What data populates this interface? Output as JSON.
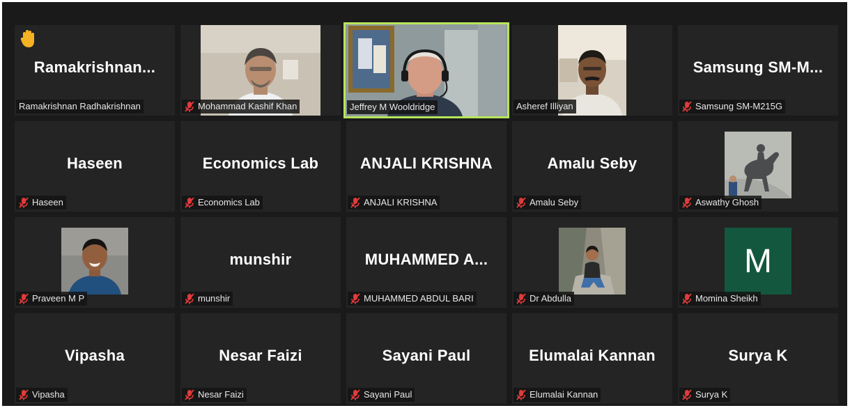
{
  "hand_raised_name": "Ramakrishnan Radhakrishnan",
  "tiles": [
    {
      "id": "ramakrishnan",
      "display": "Ramakrishnan...",
      "label": "Ramakrishnan Radhakrishnan",
      "muted": false,
      "hand_raised": true
    },
    {
      "id": "kashif",
      "display": "",
      "label": "Mohammad Kashif Khan",
      "muted": true,
      "video": "man-white-shirt"
    },
    {
      "id": "jeffrey",
      "display": "",
      "label": "Jeffrey M Wooldridge",
      "muted": false,
      "active_speaker": true,
      "video": "man-headset"
    },
    {
      "id": "asheref",
      "display": "",
      "label": "Asheref Illiyan",
      "muted": false,
      "video": "man-mustache"
    },
    {
      "id": "samsung",
      "display": "Samsung SM-M...",
      "label": "Samsung SM-M215G",
      "muted": true
    },
    {
      "id": "haseen",
      "display": "Haseen",
      "label": "Haseen",
      "muted": true
    },
    {
      "id": "econlab",
      "display": "Economics Lab",
      "label": "Economics Lab",
      "muted": true
    },
    {
      "id": "anjali",
      "display": "ANJALI KRISHNA",
      "label": "ANJALI KRISHNA",
      "muted": true
    },
    {
      "id": "amalu",
      "display": "Amalu Seby",
      "label": "Amalu Seby",
      "muted": true
    },
    {
      "id": "aswathy",
      "display": "",
      "label": "Aswathy Ghosh",
      "muted": true,
      "video": "horse-rider-image"
    },
    {
      "id": "praveen",
      "display": "",
      "label": "Praveen M P",
      "muted": true,
      "video": "man-photo"
    },
    {
      "id": "munshir",
      "display": "munshir",
      "label": "munshir",
      "muted": true
    },
    {
      "id": "muhammed",
      "display": "MUHAMMED A...",
      "label": "MUHAMMED ABDUL BARI",
      "muted": true
    },
    {
      "id": "abdulla",
      "display": "",
      "label": "Dr Abdulla",
      "muted": true,
      "video": "man-sitting-on-rock"
    },
    {
      "id": "momina",
      "display": "",
      "label": "Momina Sheikh",
      "muted": true,
      "avatar_letter": "M",
      "avatar_color": "#14573f"
    },
    {
      "id": "vipasha",
      "display": "Vipasha",
      "label": "Vipasha",
      "muted": true
    },
    {
      "id": "nesar",
      "display": "Nesar Faizi",
      "label": "Nesar Faizi",
      "muted": true
    },
    {
      "id": "sayani",
      "display": "Sayani Paul",
      "label": "Sayani Paul",
      "muted": true
    },
    {
      "id": "elumalai",
      "display": "Elumalai Kannan",
      "label": "Elumalai Kannan",
      "muted": true
    },
    {
      "id": "surya",
      "display": "Surya K",
      "label": "Surya K",
      "muted": true
    }
  ],
  "colors": {
    "background": "#1a1a1a",
    "tile": "#242424",
    "active_border": "#b7e55a",
    "muted_icon": "#e03b3b",
    "hand_icon": "#f5b324"
  },
  "icons": {
    "muted": "mic-muted-icon",
    "hand": "raised-hand-icon"
  }
}
